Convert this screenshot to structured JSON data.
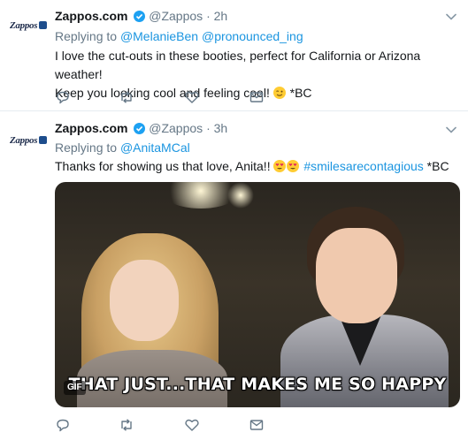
{
  "tweets": [
    {
      "avatar_text": "Zappos",
      "name": "Zappos.com",
      "handle": "@Zappos",
      "separator": "·",
      "time": "2h",
      "replying_prefix": "Replying to",
      "replying_to": [
        "@MelanieBen",
        "@pronounced_ing"
      ],
      "text_line1": "I love the cut-outs in these booties, perfect for California or Arizona weather!",
      "text_line2": "Keep you looking cool and feeling cool!",
      "emoji": "winking-face",
      "signoff": "*BC"
    },
    {
      "avatar_text": "Zappos",
      "name": "Zappos.com",
      "handle": "@Zappos",
      "separator": "·",
      "time": "3h",
      "replying_prefix": "Replying to",
      "replying_to": [
        "@AnitaMCal"
      ],
      "text": "Thanks for showing us that love, Anita!!",
      "emojis": [
        "heart-eyes-face",
        "heart-eyes-face"
      ],
      "hashtag": "#smilesarecontagious",
      "signoff": "*BC",
      "media": {
        "caption": "THAT JUST...THAT MAKES ME SO HAPPY",
        "badge": "GIF"
      }
    }
  ],
  "icons": {
    "reply": "reply-icon",
    "retweet": "retweet-icon",
    "like": "heart-icon",
    "dm": "envelope-icon",
    "more": "chevron-down-icon",
    "verified": "verified-badge-icon"
  },
  "colors": {
    "link": "#1b95e0",
    "secondary_text": "#657786",
    "verified": "#1da1f2",
    "divider": "#e6ecf0"
  }
}
